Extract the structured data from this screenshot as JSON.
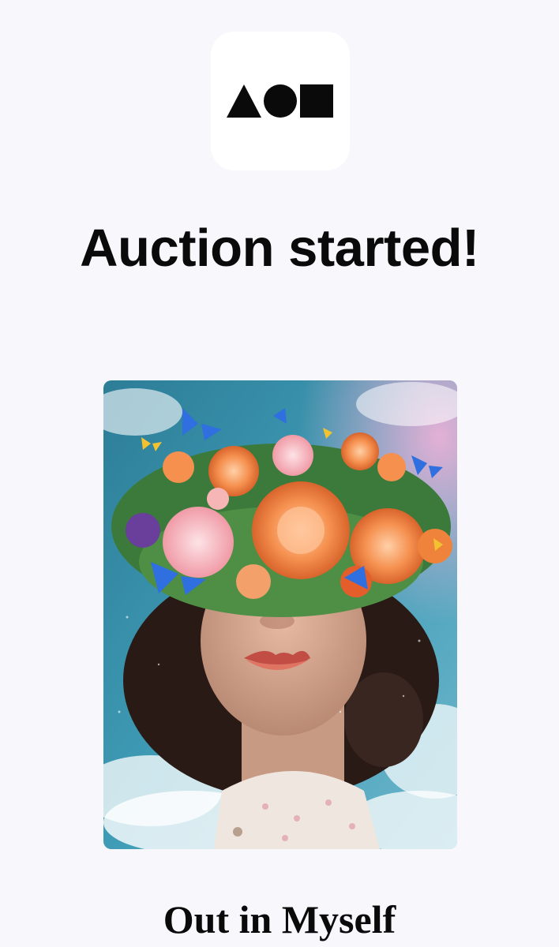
{
  "app": {
    "logo_icon": "triangle-circle-square-logo-icon"
  },
  "notification": {
    "headline": "Auction started!"
  },
  "artwork": {
    "image_icon": "floral-portrait-artwork",
    "title": "Out in Myself"
  },
  "colors": {
    "background": "#f8f7fc",
    "logo_tile": "#ffffff",
    "text": "#0a0a0a"
  }
}
